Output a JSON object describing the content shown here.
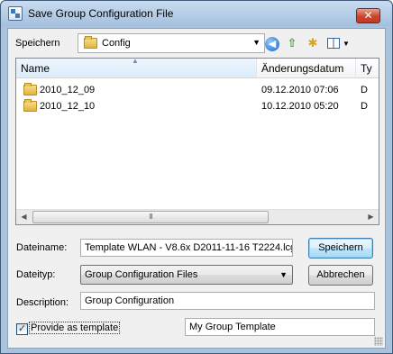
{
  "window": {
    "title": "Save Group Configuration File",
    "close_glyph": "✕"
  },
  "nav": {
    "look_in_label": "Speichern",
    "current_folder": "Config"
  },
  "filelist": {
    "columns": [
      "Name",
      "Änderungsdatum",
      "Ty"
    ],
    "rows": [
      {
        "name": "2010_12_09",
        "date": "09.12.2010 07:06",
        "type": "D"
      },
      {
        "name": "2010_12_10",
        "date": "10.12.2010 05:20",
        "type": "D"
      }
    ],
    "scroll_thumb_glyph": "III"
  },
  "form": {
    "filename_label": "Dateiname:",
    "filename_value": "Template WLAN - V8.6x D2011-11-16 T2224.lcg",
    "filetype_label": "Dateityp:",
    "filetype_value": "Group Configuration Files",
    "description_label": "Description:",
    "description_value": "Group Configuration",
    "template_checkbox_label": "Provide as template",
    "template_checked": true,
    "template_name_value": "My Group Template"
  },
  "buttons": {
    "save": "Speichern",
    "cancel": "Abbrechen"
  },
  "icons": [
    "window-app-icon",
    "folder-icon",
    "back-icon",
    "up-folder-icon",
    "new-folder-icon",
    "views-menu-icon",
    "sort-up-icon",
    "chevron-down-icon"
  ]
}
